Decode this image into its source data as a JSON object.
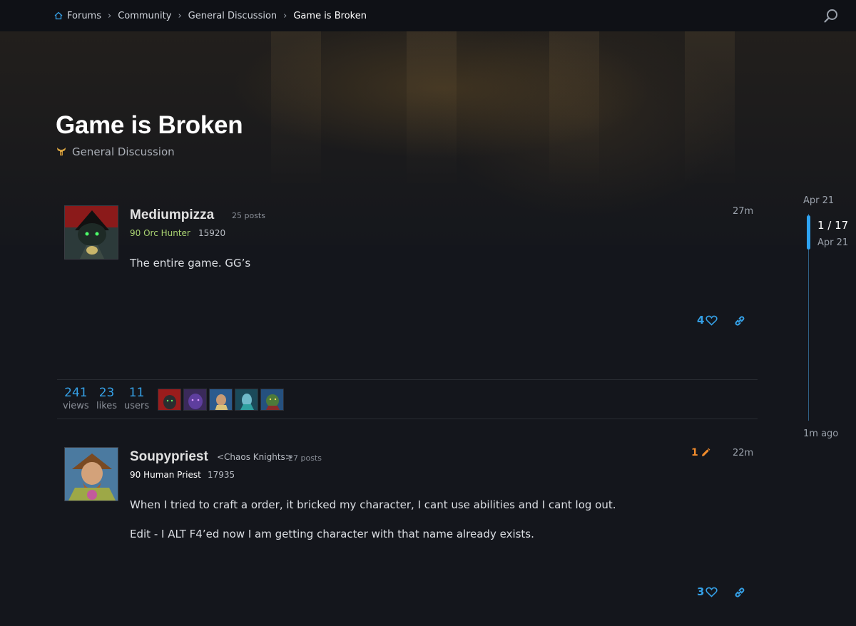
{
  "breadcrumb": {
    "items": [
      "Forums",
      "Community",
      "General Discussion",
      "Game is Broken"
    ]
  },
  "topic": {
    "title": "Game is Broken",
    "category": "General Discussion"
  },
  "posts": [
    {
      "username": "Mediumpizza",
      "guild": "",
      "post_count": "25 posts",
      "class_info": "90 Orc Hunter",
      "class_color": "#a9d271",
      "item_level": "15920",
      "time": "27m",
      "body": [
        "The entire game. GG’s"
      ],
      "likes": "4",
      "edits": ""
    },
    {
      "username": "Soupypriest",
      "guild": "<Chaos Knights>",
      "post_count": "27 posts",
      "class_info": "90 Human Priest",
      "class_color": "#ffffff",
      "item_level": "17935",
      "time": "22m",
      "body": [
        "When I tried to craft a order, it bricked my character, I cant use abilities and I cant log out.",
        "Edit - I ALT F4’ed now I am getting character with that name already exists."
      ],
      "likes": "3",
      "edits": "1"
    }
  ],
  "stats": {
    "views": {
      "num": "241",
      "label": "views"
    },
    "likes": {
      "num": "23",
      "label": "likes"
    },
    "users": {
      "num": "11",
      "label": "users"
    }
  },
  "timeline": {
    "top_date": "Apr 21",
    "position": "1 / 17",
    "current_date": "Apr 21",
    "bottom_label": "1m ago"
  },
  "colors": {
    "accent": "#35a0e6",
    "edit": "#f08b2c",
    "background": "#14161c"
  },
  "icons": [
    "home-icon",
    "search-icon",
    "category-horns-icon",
    "heart-icon",
    "link-icon",
    "pencil-icon"
  ]
}
